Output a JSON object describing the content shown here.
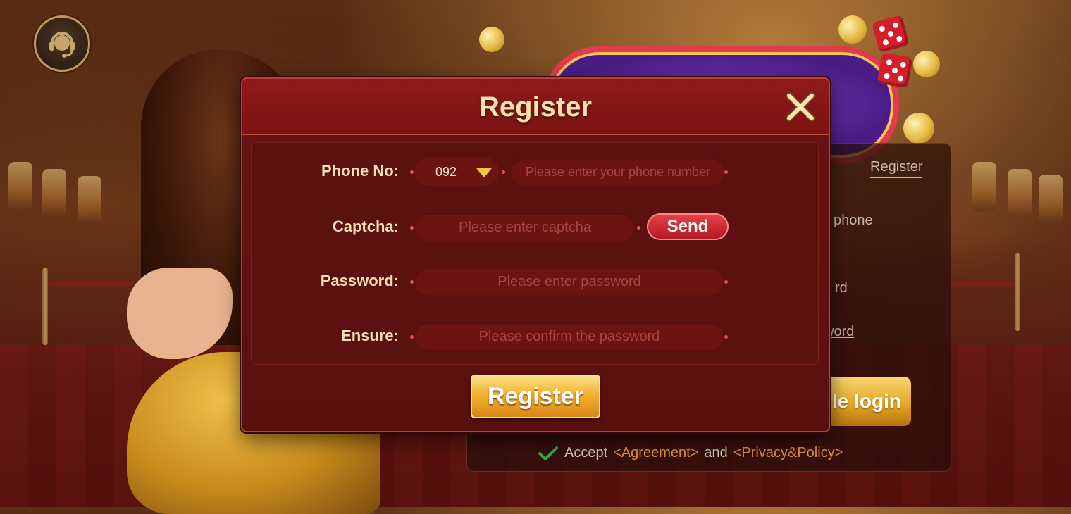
{
  "background_login": {
    "tab_register": "Register",
    "phone_fragment": "phone",
    "password_fragment": "rd",
    "forgot_fragment": "word",
    "mobile_login_fragment": "bile login",
    "accept_label": "Accept",
    "agreement_link": "<Agreement>",
    "and_text": "and",
    "privacy_link": "<Privacy&Policy>"
  },
  "modal": {
    "title": "Register",
    "phone": {
      "label": "Phone No:",
      "country_code": "092",
      "placeholder": "Please enter your phone number"
    },
    "captcha": {
      "label": "Captcha:",
      "placeholder": "Please enter captcha",
      "send_label": "Send"
    },
    "password": {
      "label": "Password:",
      "placeholder": "Please enter password"
    },
    "ensure": {
      "label": "Ensure:",
      "placeholder": "Please confirm the password"
    },
    "register_label": "Register"
  },
  "icons": {
    "support": "headset-support-icon",
    "close": "close-icon",
    "dropdown": "triangle-down-icon",
    "check": "checkmark-icon"
  },
  "colors": {
    "modal_bg": "#5a0f0f",
    "label_text": "#f6dfb4",
    "placeholder_text": "#a8463e",
    "send_button": "#c21f2a",
    "register_button": "#f2b32f",
    "link": "#e0923a",
    "check": "#2ea84a"
  }
}
